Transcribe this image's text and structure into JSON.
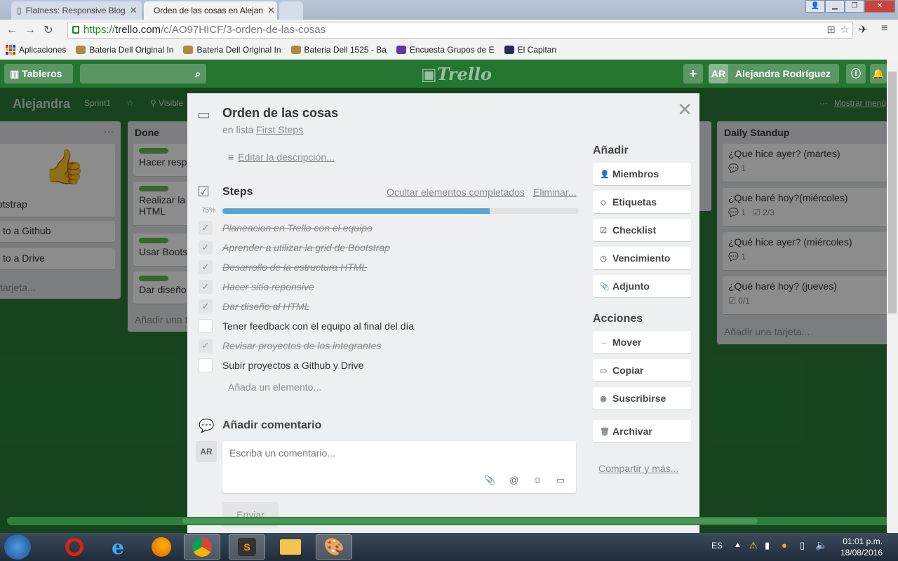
{
  "browser": {
    "tabs": [
      {
        "title": "Flatness: Responsive Blog"
      },
      {
        "title": "Orden de las cosas en Alejan"
      }
    ],
    "url": {
      "scheme": "https://",
      "host": "trello.com",
      "path": "/c/AO97HICF/3-orden-de-las-cosas"
    },
    "bookmarks": [
      {
        "label": "Aplicaciones"
      },
      {
        "label": "Bateria Dell Original In"
      },
      {
        "label": "Bateria Dell Original In"
      },
      {
        "label": "Bateria Dell 1525 - Ba"
      },
      {
        "label": "Encuesta Grupos de E"
      },
      {
        "label": "El Capitan"
      }
    ]
  },
  "header": {
    "boards_label": "Tableros",
    "logo": "Trello",
    "add_label": "+",
    "user_initials": "AR",
    "user_name": "Alejandra Rodríguez"
  },
  "board": {
    "name": "Alejandra",
    "sprint": "Sprint1",
    "visibility": "Visible",
    "show_menu": "Mostrar menú"
  },
  "lists": {
    "left": {
      "cards": [
        "otstrap",
        "to a Github",
        "to a Drive"
      ],
      "add": "tarjeta..."
    },
    "done": {
      "title": "Done",
      "cards": [
        "Hacer resp",
        "Realizar la",
        "HTML",
        "Usar Boots",
        "Dar diseño"
      ],
      "add": "Añadir una t"
    },
    "daily": {
      "title": "Daily Standup",
      "cards": [
        {
          "title": "¿Que hice ayer? (martes)",
          "comments": "1",
          "checklist": ""
        },
        {
          "title": "¿Que haré hoy?(miércoles)",
          "comments": "1",
          "checklist": "2/3"
        },
        {
          "title": "¿Qué hice ayer? (miércoles)",
          "comments": "1",
          "checklist": ""
        },
        {
          "title": "¿Qué haré hoy? (jueves)",
          "comments": "",
          "checklist": "0/1"
        }
      ],
      "add": "Añadir una tarjeta..."
    }
  },
  "card_modal": {
    "title": "Orden de las cosas",
    "in_list_prefix": "en lista",
    "list_name": "First Steps",
    "edit_description": "Editar la descripción...",
    "checklist": {
      "title": "Steps",
      "hide_completed": "Ocultar elementos completados",
      "delete": "Eliminar...",
      "progress_label": "75%",
      "progress": 0.75,
      "items": [
        {
          "text": "Planeacion en Trello con el equipo",
          "done": true
        },
        {
          "text": "Aprender a utilizar la grid de Bootstrap",
          "done": true
        },
        {
          "text": "Desarrollo de la estructura HTML",
          "done": true
        },
        {
          "text": "Hacer sitio reponsive",
          "done": true
        },
        {
          "text": "Dar diseño al HTML",
          "done": true
        },
        {
          "text": "Tener feedback con el equipo al final del día",
          "done": false
        },
        {
          "text": "Revisar proyectos de los integrantes",
          "done": true
        },
        {
          "text": "Subir proyectos a Github y Drive",
          "done": false
        }
      ],
      "add_item": "Añada un elemento..."
    },
    "comment": {
      "heading": "Añadir comentario",
      "avatar": "AR",
      "placeholder": "Escriba un comentario...",
      "send": "Enviar"
    },
    "sidebar": {
      "add_heading": "Añadir",
      "add_buttons": [
        {
          "label": "Miembros",
          "icon": "person-icon"
        },
        {
          "label": "Etiquetas",
          "icon": "tag-icon"
        },
        {
          "label": "Checklist",
          "icon": "checkbox-icon"
        },
        {
          "label": "Vencimiento",
          "icon": "clock-icon"
        },
        {
          "label": "Adjunto",
          "icon": "paperclip-icon"
        }
      ],
      "actions_heading": "Acciones",
      "action_buttons": [
        {
          "label": "Mover",
          "icon": "arrow-right-icon"
        },
        {
          "label": "Copiar",
          "icon": "card-icon"
        },
        {
          "label": "Suscribirse",
          "icon": "eye-icon"
        },
        {
          "label": "Archivar",
          "icon": "archive-icon"
        }
      ],
      "share": "Compartir y más..."
    }
  },
  "taskbar": {
    "lang": "ES",
    "time": "01:01 p.m.",
    "date": "18/08/2016"
  }
}
